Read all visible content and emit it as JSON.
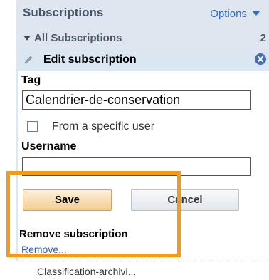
{
  "header": {
    "title": "Subscriptions",
    "options_label": "Options"
  },
  "list": {
    "group_label": "All Subscriptions",
    "group_count": "2"
  },
  "edit_panel": {
    "title": "Edit subscription",
    "tag_label": "Tag",
    "tag_value": "Calendrier-de-conservation",
    "specific_user_label": "From a specific user",
    "specific_user_checked": false,
    "username_label": "Username",
    "username_value": "",
    "save_label": "Save",
    "cancel_label": "Cancel",
    "remove_title": "Remove subscription",
    "remove_link": "Remove..."
  },
  "next_item": {
    "label": "Classification-archivi..."
  },
  "colors": {
    "panel_bg": "#dfe6ef",
    "header_text": "#445566",
    "link": "#2e6fc6",
    "highlight": "#f29a19",
    "save_button": "#f3cf8f"
  },
  "icons": {
    "options": "chevron-down-icon",
    "group": "triangle-down-icon",
    "edit": "pencil-icon",
    "close": "close-icon"
  }
}
